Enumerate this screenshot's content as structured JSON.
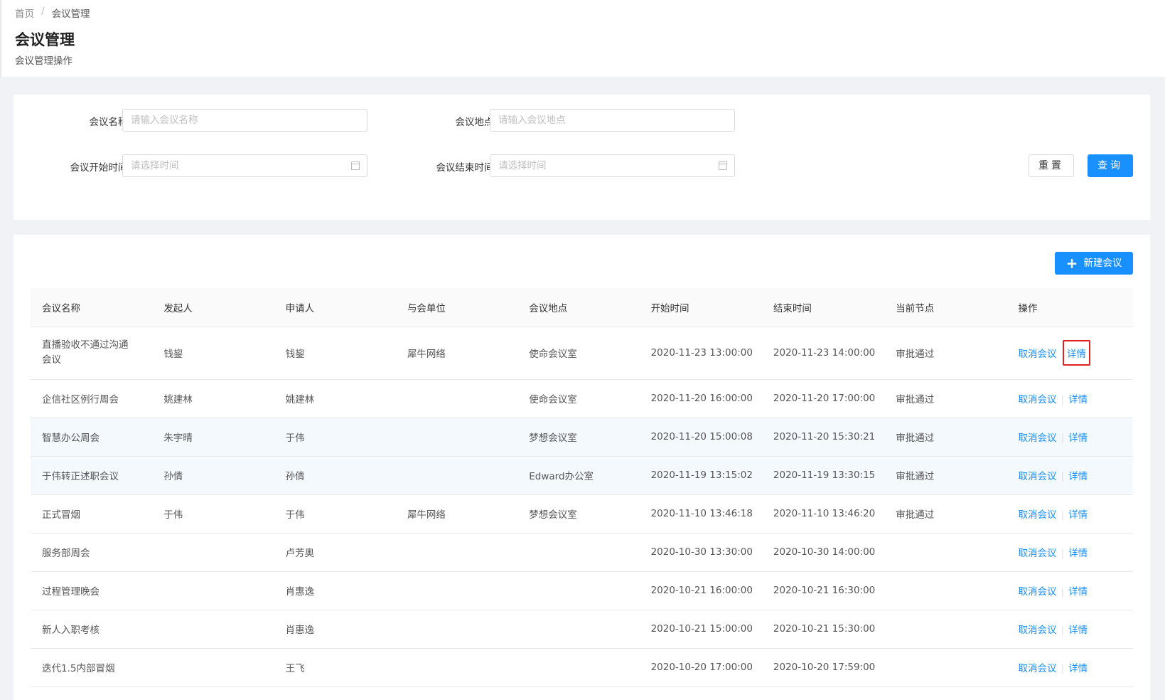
{
  "breadcrumb": {
    "home": "首页",
    "separator": "/",
    "current": "会议管理"
  },
  "page": {
    "title": "会议管理",
    "description": "会议管理操作"
  },
  "search": {
    "name_label": "会议名称:",
    "name_placeholder": "请输入会议名称",
    "location_label": "会议地点:",
    "location_placeholder": "请输入会议地点",
    "start_label": "会议开始时间:",
    "start_placeholder": "请选择时间",
    "end_label": "会议结束时间:",
    "end_placeholder": "请选择时间",
    "reset_label": "重置",
    "query_label": "查询"
  },
  "toolbar": {
    "new_meeting_label": "新建会议",
    "new_icon": "plus-icon"
  },
  "table": {
    "columns": [
      "会议名称",
      "发起人",
      "申请人",
      "与会单位",
      "会议地点",
      "开始时间",
      "结束时间",
      "当前节点",
      "操作"
    ],
    "cancel_label": "取消会议",
    "detail_label": "详情",
    "rows": [
      {
        "name": "直播验收不通过沟通会议",
        "initiator": "钱鋆",
        "applicant": "钱鋆",
        "unit": "犀牛网络",
        "location": "使命会议室",
        "start": "2020-11-23 13:00:00",
        "end": "2020-11-23 14:00:00",
        "node": "审批通过"
      },
      {
        "name": "企信社区例行周会",
        "initiator": "姚建林",
        "applicant": "姚建林",
        "unit": "",
        "location": "使命会议室",
        "start": "2020-11-20 16:00:00",
        "end": "2020-11-20 17:00:00",
        "node": "审批通过"
      },
      {
        "name": "智慧办公周会",
        "initiator": "朱宇晴",
        "applicant": "于伟",
        "unit": "",
        "location": "梦想会议室",
        "start": "2020-11-20 15:00:08",
        "end": "2020-11-20 15:30:21",
        "node": "审批通过"
      },
      {
        "name": "于伟转正述职会议",
        "initiator": "孙倩",
        "applicant": "孙倩",
        "unit": "",
        "location": "Edward办公室",
        "start": "2020-11-19 13:15:02",
        "end": "2020-11-19 13:30:15",
        "node": "审批通过"
      },
      {
        "name": "正式冒烟",
        "initiator": "于伟",
        "applicant": "于伟",
        "unit": "犀牛网络",
        "location": "梦想会议室",
        "start": "2020-11-10 13:46:18",
        "end": "2020-11-10 13:46:20",
        "node": "审批通过"
      },
      {
        "name": "服务部周会",
        "initiator": "",
        "applicant": "卢芳奥",
        "unit": "",
        "location": "",
        "start": "2020-10-30 13:30:00",
        "end": "2020-10-30 14:00:00",
        "node": ""
      },
      {
        "name": "过程管理晚会",
        "initiator": "",
        "applicant": "肖惠逸",
        "unit": "",
        "location": "",
        "start": "2020-10-21 16:00:00",
        "end": "2020-10-21 16:30:00",
        "node": ""
      },
      {
        "name": "新人入职考核",
        "initiator": "",
        "applicant": "肖惠逸",
        "unit": "",
        "location": "",
        "start": "2020-10-21 15:00:00",
        "end": "2020-10-21 15:30:00",
        "node": ""
      },
      {
        "name": "迭代1.5内部冒烟",
        "initiator": "",
        "applicant": "王飞",
        "unit": "",
        "location": "",
        "start": "2020-10-20 17:00:00",
        "end": "2020-10-20 17:59:00",
        "node": ""
      }
    ]
  },
  "colors": {
    "primary": "#1890ff",
    "highlight_box": "#e02020",
    "hover_row": "#f4f9fd"
  }
}
